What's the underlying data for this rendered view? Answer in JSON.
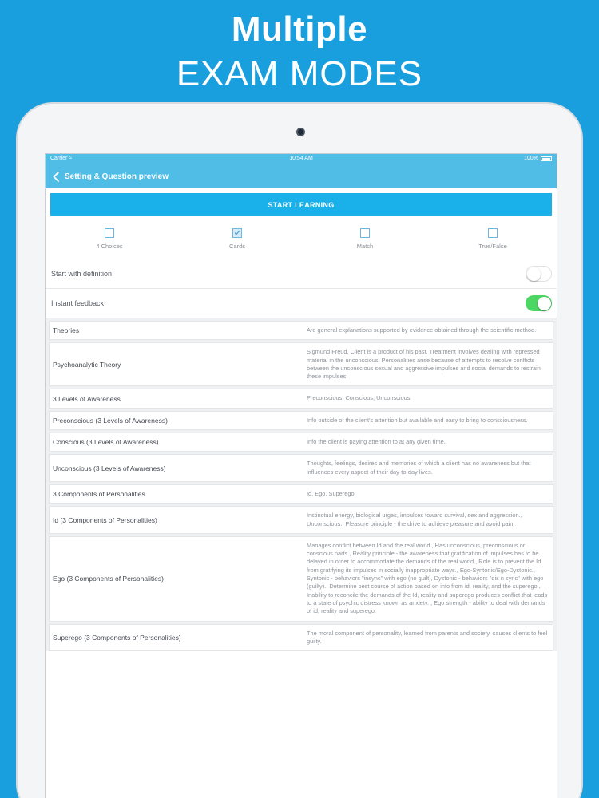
{
  "headline": {
    "line1": "Multiple",
    "line2": "EXAM MODES"
  },
  "statusbar": {
    "carrier": "Carrier",
    "time": "10:54 AM",
    "battery": "100%"
  },
  "navbar": {
    "title": "Setting & Question preview"
  },
  "start_button": "START LEARNING",
  "modes": [
    {
      "label": "4 Choices",
      "checked": false
    },
    {
      "label": "Cards",
      "checked": true
    },
    {
      "label": "Match",
      "checked": false
    },
    {
      "label": "True/False",
      "checked": false
    }
  ],
  "settings": [
    {
      "label": "Start with definition",
      "on": false
    },
    {
      "label": "Instant feedback",
      "on": true
    }
  ],
  "terms": [
    {
      "term": "Theories",
      "definition": "Are general explanations supported by evidence obtained through the scientific method."
    },
    {
      "term": "Psychoanalytic Theory",
      "definition": "Sigmund Freud, Client is a product of his past, Treatment involves dealing with repressed material in the unconscious, Personalities arise because of attempts to resolve conflicts between the unconscious sexual and aggressive impulses and social demands to restrain these impulses"
    },
    {
      "term": "3 Levels of Awareness",
      "definition": "Preconscious, Conscious, Unconscious"
    },
    {
      "term": "Preconscious (3 Levels of Awareness)",
      "definition": "Info outside of the client's attention but available and easy to bring to consciousness."
    },
    {
      "term": "Conscious (3 Levels of Awareness)",
      "definition": "Info the client is paying attention to at any given time."
    },
    {
      "term": "Unconscious (3 Levels of Awareness)",
      "definition": "Thoughts, feelings, desires and memories of which a client has no awareness but that influences every aspect of their day-to-day lives."
    },
    {
      "term": "3 Components of Personalities",
      "definition": "Id, Ego, Superego"
    },
    {
      "term": "Id (3 Components of Personalities)",
      "definition": "Instinctual energy, biological urges, impulses toward survival, sex and aggression., Unconscious., Pleasure principle - the drive to achieve pleasure and avoid pain."
    },
    {
      "term": "Ego (3 Components of Personalities)",
      "definition": "Manages conflict between Id and the real world., Has unconscious, preconscious or conscious parts., Reality principle - the awareness that gratification of impulses has to be delayed in order to accommodate the demands of the real world., Role is to prevent the Id from gratifying its impulses in socially inappropriate ways., Ego-Syntonic/Ego-Dystonic., Syntonic - behaviors \"insync\" with ego (no guilt), Dystonic - behaviors \"dis n sync\" with ego (guilty)., Determine best course of action based on info from id, reality, and the superego., Inability to reconcile the demands of the Id, reality and superego produces conflict that leads to a state of psychic distress known as anxiety. , Ego strength - ability to deal with demands of id, reality and superego."
    },
    {
      "term": "Superego (3 Components of Personalities)",
      "definition": "The moral component of personality, learned from parents and society, causes clients to feel guilty."
    }
  ],
  "colors": {
    "background": "#1a9fde",
    "navbar": "#4fbde6",
    "start_button": "#1ab1ea",
    "toggle_on": "#4cd664"
  }
}
